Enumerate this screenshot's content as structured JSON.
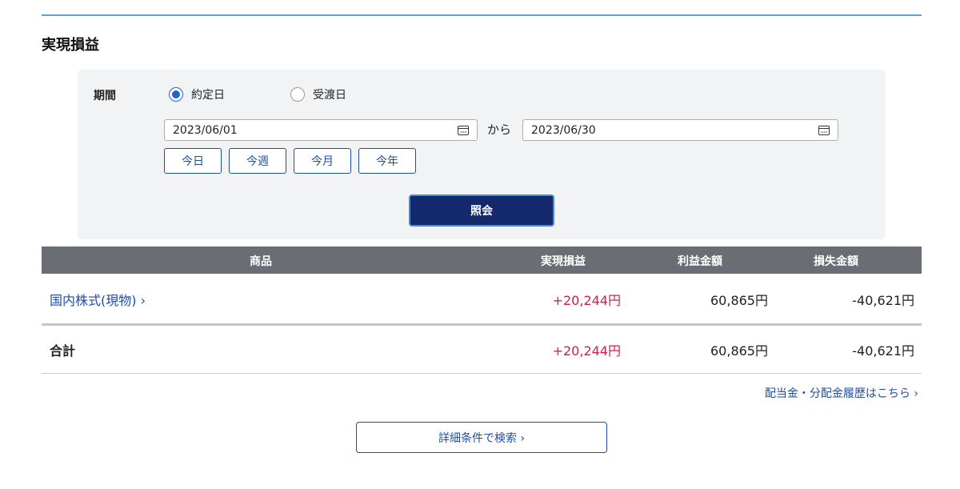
{
  "page": {
    "title": "実現損益"
  },
  "filter": {
    "period_label": "期間",
    "radio_options": [
      {
        "label": "約定日",
        "checked": true
      },
      {
        "label": "受渡日",
        "checked": false
      }
    ],
    "from_date": "2023/06/01",
    "from_separator": "から",
    "to_date": "2023/06/30",
    "quick_buttons": [
      "今日",
      "今週",
      "今月",
      "今年"
    ],
    "search_button": "照会"
  },
  "table": {
    "headers": [
      "商品",
      "実現損益",
      "利益金額",
      "損失金額"
    ],
    "rows": [
      {
        "product": "国内株式(現物) ›",
        "realized": "+20,244円",
        "profit": "60,865円",
        "loss": "-40,621円"
      }
    ],
    "total": {
      "label": "合計",
      "realized": "+20,244円",
      "profit": "60,865円",
      "loss": "-40,621円"
    }
  },
  "links": {
    "dividend_history": "配当金・分配金履歴はこちら ›",
    "detail_search": "詳細条件で検索 ›"
  },
  "colors": {
    "accent_blue": "#1e4fa3",
    "primary_button": "#14286e",
    "profit_red": "#d0224a",
    "header_gray": "#6a6d74"
  }
}
